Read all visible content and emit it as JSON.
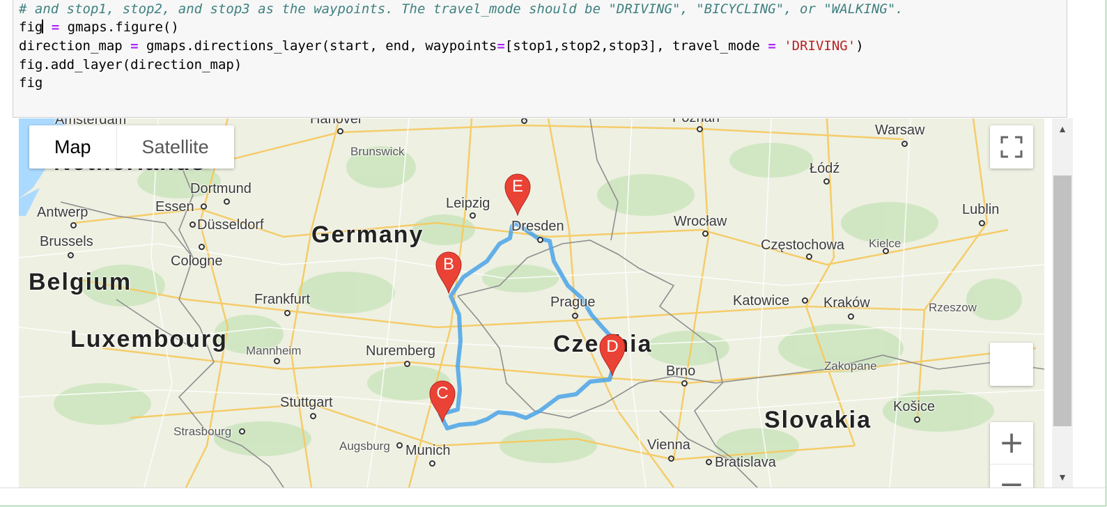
{
  "code": {
    "line1": "# and stop1, stop2, and stop3 as the waypoints. The travel_mode should be \"DRIVING\", \"BICYCLING\", or \"WALKING\".",
    "line2_a": "fig",
    "line2_b": " = ",
    "line2_c": "gmaps.figure()",
    "line3_a": "direction_map ",
    "line3_b": "=",
    "line3_c": " gmaps.directions_layer(start, end, waypoints",
    "line3_d": "=",
    "line3_e": "[stop1,stop2,stop3], travel_mode ",
    "line3_f": "=",
    "line3_g": " ",
    "line3_h": "'DRIVING'",
    "line3_i": ")",
    "line4": "fig.add_layer(direction_map)",
    "line5": "fig"
  },
  "map": {
    "type_control": {
      "map_label": "Map",
      "satellite_label": "Satellite",
      "selected": "Map"
    },
    "route_color": "#3d9be9",
    "marker_color": "#ea4335",
    "markers": [
      {
        "letter": "B"
      },
      {
        "letter": "C"
      },
      {
        "letter": "D"
      },
      {
        "letter": "E"
      }
    ],
    "countries": {
      "netherlands": "Netherlands",
      "germany": "Germany",
      "belgium": "Belgium",
      "luxembourg": "Luxembourg",
      "czechia": "Czechia",
      "slovakia": "Slovakia"
    },
    "cities": {
      "amsterdam": "Amsterdam",
      "hanover": "Hanover",
      "poznan": "Poznań",
      "warsaw": "Warsaw",
      "brunswick": "Brunswick",
      "lodz": "Łódź",
      "dortmund": "Dortmund",
      "antwerp": "Antwerp",
      "essen": "Essen",
      "leipzig": "Leipzig",
      "lublin": "Lublin",
      "dusseldorf": "Düsseldorf",
      "dresden": "Dresden",
      "wroclaw": "Wrocław",
      "brussels": "Brussels",
      "czestochowa": "Częstochowa",
      "kielce": "Kielce",
      "cologne": "Cologne",
      "frankfurt": "Frankfurt",
      "prague": "Prague",
      "katowice": "Katowice",
      "krakow": "Kraków",
      "rzeszow": "Rzeszow",
      "mannheim": "Mannheim",
      "nuremberg": "Nuremberg",
      "brno": "Brno",
      "zakopane": "Zakopane",
      "stuttgart": "Stuttgart",
      "kosice": "Košice",
      "strasbourg": "Strasbourg",
      "augsburg": "Augsburg",
      "munich": "Munich",
      "vienna": "Vienna",
      "bratislava": "Bratislava"
    },
    "controls": {
      "zoom_in": "+",
      "zoom_out": "−"
    },
    "icons": {
      "fullscreen": "fullscreen-icon",
      "pegman": "pegman-icon",
      "scroll_up": "▲",
      "scroll_down": "▼"
    }
  }
}
